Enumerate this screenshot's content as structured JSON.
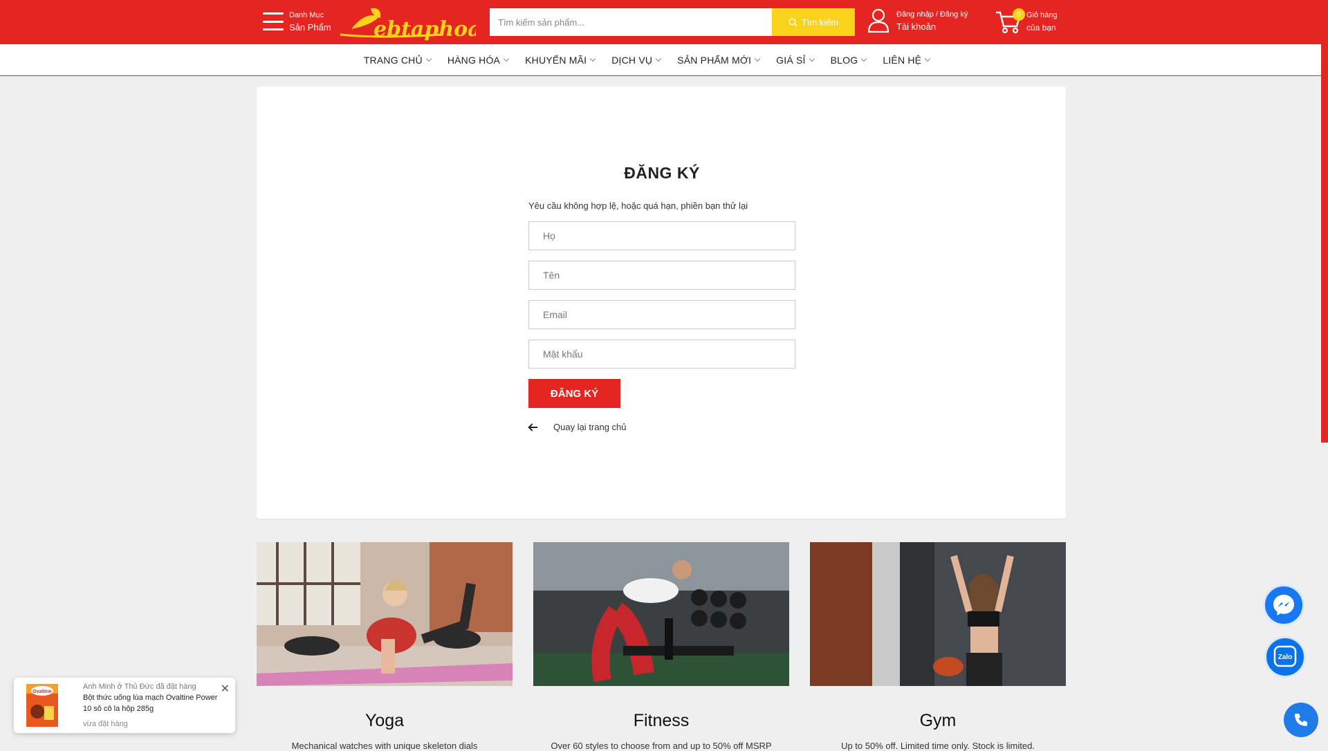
{
  "header": {
    "menu": {
      "line1": "Danh Mục",
      "line2": "Sản Phẩm"
    },
    "logo_text": "ebtaphoa.vn",
    "search": {
      "placeholder": "Tìm kiếm sản phẩm...",
      "button": "Tìm kiếm"
    },
    "account": {
      "line1": "Đăng nhập / Đăng ký",
      "line2": "Tài khoản"
    },
    "cart": {
      "count": "0",
      "line1": "Giỏ hàng",
      "line2": "của bạn"
    },
    "brand_color": "#e52521",
    "accent_color": "#f9d21c"
  },
  "nav": {
    "items": [
      {
        "label": "TRANG CHỦ"
      },
      {
        "label": "HÀNG HÓA"
      },
      {
        "label": "KHUYẾN MÃI"
      },
      {
        "label": "DỊCH VỤ"
      },
      {
        "label": "SẢN PHẨM MỚI"
      },
      {
        "label": "GIÁ SỈ"
      },
      {
        "label": "BLOG"
      },
      {
        "label": "LIÊN HỆ"
      }
    ]
  },
  "register": {
    "title": "ĐĂNG KÝ",
    "message": "Yêu cầu không hợp lệ, hoặc quá hạn, phiền bạn thử lại",
    "fields": {
      "last_name": "Họ",
      "first_name": "Tên",
      "email": "Email",
      "password": "Mật khẩu"
    },
    "submit": "ĐĂNG KÝ",
    "back": "Quay lại trang chủ"
  },
  "tiles": [
    {
      "title": "Yoga",
      "desc": "Mechanical watches with unique skeleton dials"
    },
    {
      "title": "Fitness",
      "desc": "Over 60 styles to choose from and up to 50% off MSRP"
    },
    {
      "title": "Gym",
      "desc": "Up to 50% off. Limited time only. Stock is limited."
    }
  ],
  "toast": {
    "who": "Anh Minh ở Thủ Đức đã đặt hàng",
    "product": "Bột thức uống lúa mạch Ovaltine Power 10 sô cô la hộp 285g",
    "time": "vừa đặt hàng",
    "thumb_text": "Ovaltine"
  },
  "widgets": {
    "zalo_label": "Zalo"
  },
  "icons": [
    "menu-icon",
    "search-icon",
    "user-icon",
    "cart-icon",
    "chevron-down-icon",
    "arrow-left-icon",
    "messenger-icon",
    "zalo-icon",
    "phone-icon",
    "close-icon"
  ]
}
